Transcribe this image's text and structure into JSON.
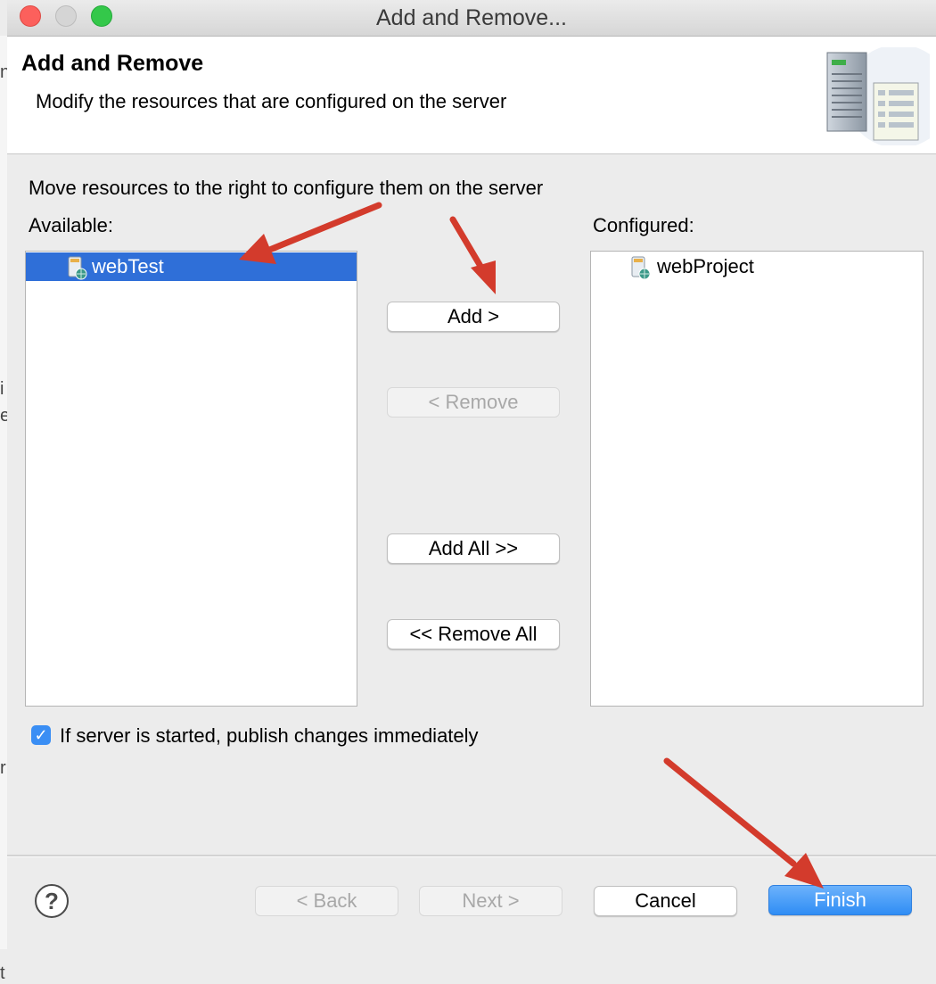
{
  "dialog": {
    "title": "Add and Remove...",
    "page_title": "Add and Remove",
    "page_description": "Modify the resources that are configured on the server"
  },
  "resources": {
    "instruction": "Move resources to the right to configure them on the server",
    "available_label": "Available:",
    "configured_label": "Configured:",
    "available_items": [
      {
        "label": "webTest",
        "selected": true
      }
    ],
    "configured_items": [
      {
        "label": "webProject",
        "selected": false
      }
    ]
  },
  "buttons": {
    "add": "Add >",
    "remove": "< Remove",
    "add_all": "Add All >>",
    "remove_all": "<< Remove All"
  },
  "publish_checkbox": {
    "label": "If server is started, publish changes immediately",
    "checked": true
  },
  "footer": {
    "back": "< Back",
    "next": "Next >",
    "cancel": "Cancel",
    "finish": "Finish"
  },
  "colors": {
    "selection": "#2f6fd8",
    "accent": "#3a8ef4",
    "annotation_arrow": "#d33b2c"
  },
  "icons": {
    "help": "?",
    "checkmark": "✓"
  }
}
